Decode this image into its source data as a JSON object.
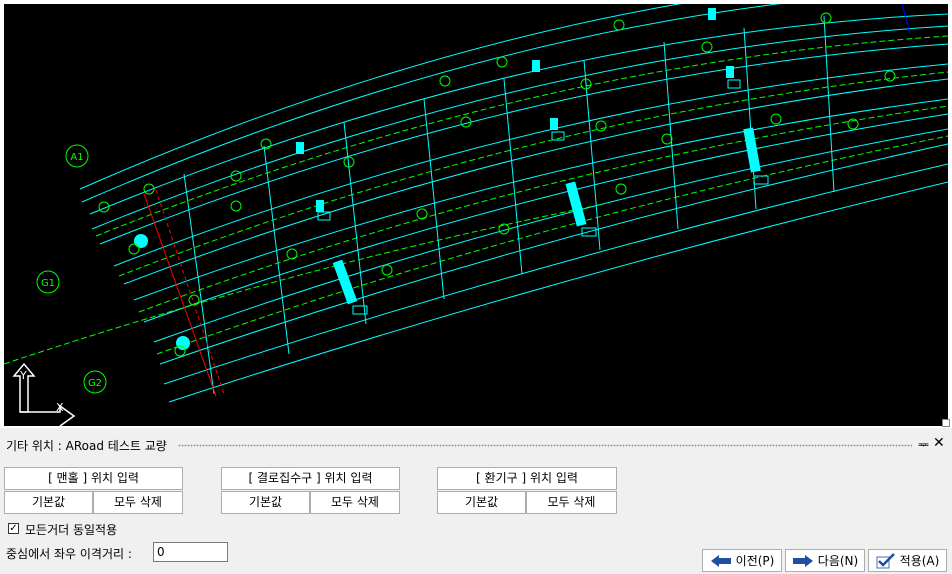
{
  "panel": {
    "title": "기타 위치 : ARoad 테스트 교량",
    "pin_glyph": "ᆓ",
    "close_glyph": "✕"
  },
  "groups": [
    {
      "input_label": "[ 맨홀 ] 위치 입력",
      "default_label": "기본값",
      "delete_label": "모두 삭제"
    },
    {
      "input_label": "[ 결로집수구 ] 위치 입력",
      "default_label": "기본값",
      "delete_label": "모두 삭제"
    },
    {
      "input_label": "[ 환기구 ] 위치 입력",
      "default_label": "기본값",
      "delete_label": "모두 삭제"
    }
  ],
  "options": {
    "same_all_girders_label": "모든거더 동일적용",
    "same_all_girders_checked": true,
    "distance_label": "중심에서 좌우 이격거리 :",
    "distance_value": "0"
  },
  "nav": {
    "prev_label": "이전(P)",
    "next_label": "다음(N)",
    "apply_label": "적용(A)"
  },
  "drawing": {
    "labels": {
      "a1": "A1",
      "g1": "G1",
      "g2": "G2",
      "axis_y": "Y",
      "axis_x": "X"
    },
    "colors": {
      "background": "#000000",
      "cyan": "#00ffff",
      "green": "#00ff00",
      "red": "#ff0000",
      "blue": "#0000ff"
    }
  }
}
